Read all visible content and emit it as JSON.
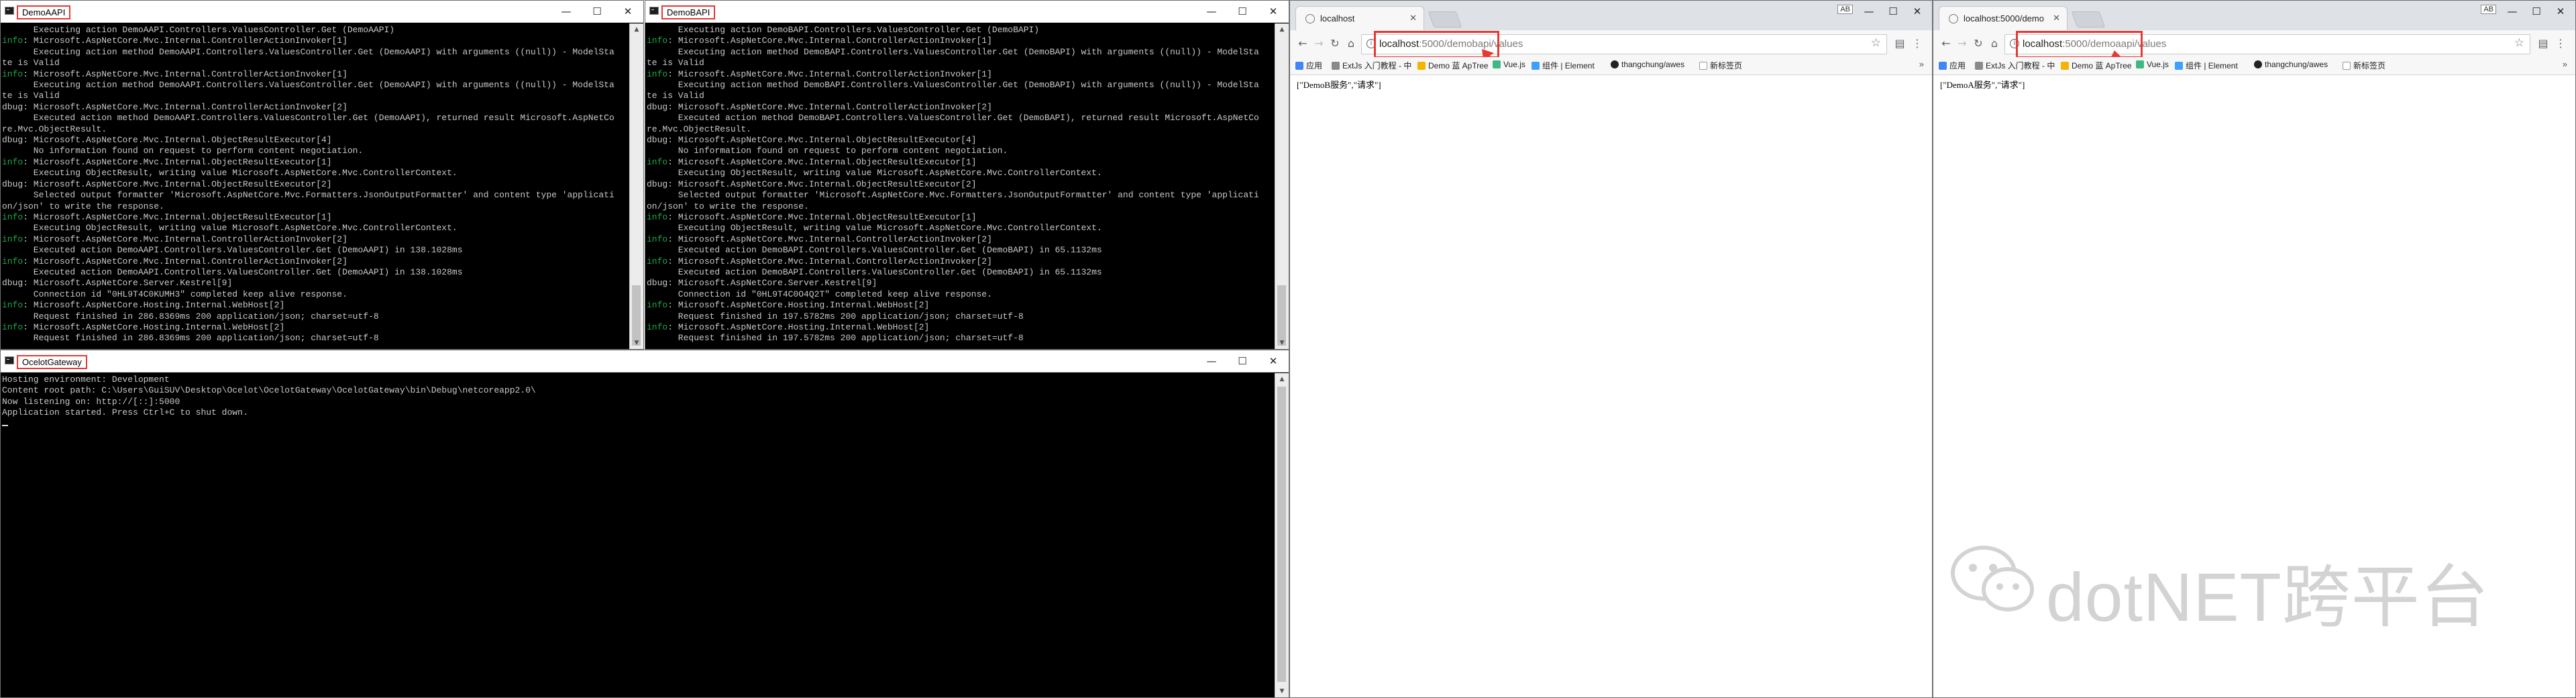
{
  "windows": {
    "demoa": {
      "title": "DemoAAPI",
      "lines": [
        {
          "p": "",
          "t": "      Executing action DemoAAPI.Controllers.ValuesController.Get (DemoAAPI)"
        },
        {
          "p": "info",
          "t": ": Microsoft.AspNetCore.Mvc.Internal.ControllerActionInvoker[1]"
        },
        {
          "p": "",
          "t": "      Executing action method DemoAAPI.Controllers.ValuesController.Get (DemoAAPI) with arguments ((null)) - ModelSta"
        },
        {
          "p": "",
          "t": "te is Valid"
        },
        {
          "p": "info",
          "t": ": Microsoft.AspNetCore.Mvc.Internal.ControllerActionInvoker[1]"
        },
        {
          "p": "",
          "t": "      Executing action method DemoAAPI.Controllers.ValuesController.Get (DemoAAPI) with arguments ((null)) - ModelSta"
        },
        {
          "p": "",
          "t": "te is Valid"
        },
        {
          "p": "dbug",
          "t": ": Microsoft.AspNetCore.Mvc.Internal.ControllerActionInvoker[2]"
        },
        {
          "p": "",
          "t": "      Executed action method DemoAAPI.Controllers.ValuesController.Get (DemoAAPI), returned result Microsoft.AspNetCo"
        },
        {
          "p": "",
          "t": "re.Mvc.ObjectResult."
        },
        {
          "p": "dbug",
          "t": ": Microsoft.AspNetCore.Mvc.Internal.ObjectResultExecutor[4]"
        },
        {
          "p": "",
          "t": "      No information found on request to perform content negotiation."
        },
        {
          "p": "info",
          "t": ": Microsoft.AspNetCore.Mvc.Internal.ObjectResultExecutor[1]"
        },
        {
          "p": "",
          "t": "      Executing ObjectResult, writing value Microsoft.AspNetCore.Mvc.ControllerContext."
        },
        {
          "p": "dbug",
          "t": ": Microsoft.AspNetCore.Mvc.Internal.ObjectResultExecutor[2]"
        },
        {
          "p": "",
          "t": "      Selected output formatter 'Microsoft.AspNetCore.Mvc.Formatters.JsonOutputFormatter' and content type 'applicati"
        },
        {
          "p": "",
          "t": "on/json' to write the response."
        },
        {
          "p": "info",
          "t": ": Microsoft.AspNetCore.Mvc.Internal.ObjectResultExecutor[1]"
        },
        {
          "p": "",
          "t": "      Executing ObjectResult, writing value Microsoft.AspNetCore.Mvc.ControllerContext."
        },
        {
          "p": "info",
          "t": ": Microsoft.AspNetCore.Mvc.Internal.ControllerActionInvoker[2]"
        },
        {
          "p": "",
          "t": "      Executed action DemoAAPI.Controllers.ValuesController.Get (DemoAAPI) in 138.1028ms"
        },
        {
          "p": "info",
          "t": ": Microsoft.AspNetCore.Mvc.Internal.ControllerActionInvoker[2]"
        },
        {
          "p": "",
          "t": "      Executed action DemoAAPI.Controllers.ValuesController.Get (DemoAAPI) in 138.1028ms"
        },
        {
          "p": "dbug",
          "t": ": Microsoft.AspNetCore.Server.Kestrel[9]"
        },
        {
          "p": "",
          "t": "      Connection id \"0HL9T4C0KUMH3\" completed keep alive response."
        },
        {
          "p": "info",
          "t": ": Microsoft.AspNetCore.Hosting.Internal.WebHost[2]"
        },
        {
          "p": "",
          "t": "      Request finished in 286.8369ms 200 application/json; charset=utf-8"
        },
        {
          "p": "info",
          "t": ": Microsoft.AspNetCore.Hosting.Internal.WebHost[2]"
        },
        {
          "p": "",
          "t": "      Request finished in 286.8369ms 200 application/json; charset=utf-8"
        }
      ]
    },
    "demob": {
      "title": "DemoBAPI",
      "lines": [
        {
          "p": "",
          "t": "      Executing action DemoBAPI.Controllers.ValuesController.Get (DemoBAPI)"
        },
        {
          "p": "info",
          "t": ": Microsoft.AspNetCore.Mvc.Internal.ControllerActionInvoker[1]"
        },
        {
          "p": "",
          "t": "      Executing action method DemoBAPI.Controllers.ValuesController.Get (DemoBAPI) with arguments ((null)) - ModelSta"
        },
        {
          "p": "",
          "t": "te is Valid"
        },
        {
          "p": "info",
          "t": ": Microsoft.AspNetCore.Mvc.Internal.ControllerActionInvoker[1]"
        },
        {
          "p": "",
          "t": "      Executing action method DemoBAPI.Controllers.ValuesController.Get (DemoBAPI) with arguments ((null)) - ModelSta"
        },
        {
          "p": "",
          "t": "te is Valid"
        },
        {
          "p": "dbug",
          "t": ": Microsoft.AspNetCore.Mvc.Internal.ControllerActionInvoker[2]"
        },
        {
          "p": "",
          "t": "      Executed action method DemoBAPI.Controllers.ValuesController.Get (DemoBAPI), returned result Microsoft.AspNetCo"
        },
        {
          "p": "",
          "t": "re.Mvc.ObjectResult."
        },
        {
          "p": "dbug",
          "t": ": Microsoft.AspNetCore.Mvc.Internal.ObjectResultExecutor[4]"
        },
        {
          "p": "",
          "t": "      No information found on request to perform content negotiation."
        },
        {
          "p": "info",
          "t": ": Microsoft.AspNetCore.Mvc.Internal.ObjectResultExecutor[1]"
        },
        {
          "p": "",
          "t": "      Executing ObjectResult, writing value Microsoft.AspNetCore.Mvc.ControllerContext."
        },
        {
          "p": "dbug",
          "t": ": Microsoft.AspNetCore.Mvc.Internal.ObjectResultExecutor[2]"
        },
        {
          "p": "",
          "t": "      Selected output formatter 'Microsoft.AspNetCore.Mvc.Formatters.JsonOutputFormatter' and content type 'applicati"
        },
        {
          "p": "",
          "t": "on/json' to write the response."
        },
        {
          "p": "info",
          "t": ": Microsoft.AspNetCore.Mvc.Internal.ObjectResultExecutor[1]"
        },
        {
          "p": "",
          "t": "      Executing ObjectResult, writing value Microsoft.AspNetCore.Mvc.ControllerContext."
        },
        {
          "p": "info",
          "t": ": Microsoft.AspNetCore.Mvc.Internal.ControllerActionInvoker[2]"
        },
        {
          "p": "",
          "t": "      Executed action DemoBAPI.Controllers.ValuesController.Get (DemoBAPI) in 65.1132ms"
        },
        {
          "p": "info",
          "t": ": Microsoft.AspNetCore.Mvc.Internal.ControllerActionInvoker[2]"
        },
        {
          "p": "",
          "t": "      Executed action DemoBAPI.Controllers.ValuesController.Get (DemoBAPI) in 65.1132ms"
        },
        {
          "p": "dbug",
          "t": ": Microsoft.AspNetCore.Server.Kestrel[9]"
        },
        {
          "p": "",
          "t": "      Connection id \"0HL9T4C0O4Q2T\" completed keep alive response."
        },
        {
          "p": "info",
          "t": ": Microsoft.AspNetCore.Hosting.Internal.WebHost[2]"
        },
        {
          "p": "",
          "t": "      Request finished in 197.5782ms 200 application/json; charset=utf-8"
        },
        {
          "p": "info",
          "t": ": Microsoft.AspNetCore.Hosting.Internal.WebHost[2]"
        },
        {
          "p": "",
          "t": "      Request finished in 197.5782ms 200 application/json; charset=utf-8"
        }
      ]
    },
    "gateway": {
      "title": "OcelotGateway",
      "lines": [
        {
          "p": "",
          "t": "Hosting environment: Development"
        },
        {
          "p": "",
          "t": "Content root path: C:\\Users\\GuiSUV\\Desktop\\Ocelot\\OcelotGateway\\OcelotGateway\\bin\\Debug\\netcoreapp2.0\\"
        },
        {
          "p": "",
          "t": "Now listening on: http://[::]:5000"
        },
        {
          "p": "",
          "t": "Application started. Press Ctrl+C to shut down."
        }
      ]
    }
  },
  "console_prefix": {
    "info": "info",
    "dbug": "dbug"
  },
  "browsers": {
    "left": {
      "tab_title": "localhost",
      "user_badge": "AB",
      "url_host": "localhost",
      "url_path": ":5000/demobapi/values",
      "body": "[\"DemoB服务\",\"请求\"]"
    },
    "right": {
      "tab_title": "localhost:5000/demo",
      "user_badge": "AB",
      "url_host": "localhost",
      "url_path": ":5000/demoaapi/values",
      "body": "[\"DemoA服务\",\"请求\"]"
    }
  },
  "bookmarks": [
    "应用",
    "ExtJs 入门教程 - 中",
    "Demo 蓝 ApTree",
    "Vue.js",
    "组件 | Element",
    "thangchung/awes",
    "新标签页"
  ],
  "bookmarks_more": "»",
  "window_controls": {
    "min": "—",
    "max": "☐",
    "close": "✕"
  },
  "watermark": "dotNET跨平台",
  "colors": {
    "highlight": "#e53935",
    "console_info": "#19a94a",
    "console_bg": "#000000"
  }
}
